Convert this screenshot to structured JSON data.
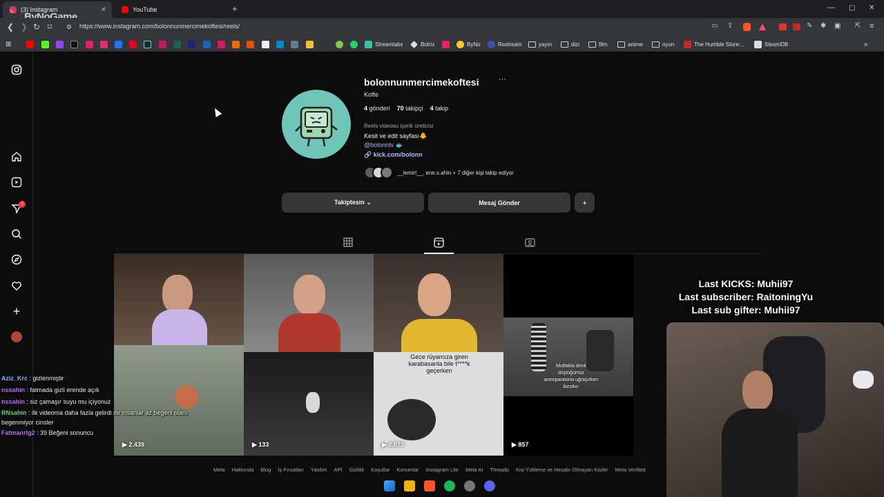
{
  "browser": {
    "tabs": [
      {
        "label": "(3) Instagram",
        "active": true
      },
      {
        "label": "YouTube",
        "active": false
      }
    ],
    "url": "https://www.instagram.com/bolonnunmercimekoftesi/reels/",
    "bookmarks": [
      "Streamlabs",
      "Botrix",
      "ByNo",
      "Restream",
      "yayın",
      "dizi",
      "film",
      "anime",
      "oyun",
      "The Humble Store:...",
      "SteamDB"
    ]
  },
  "watermark": "ByNoGame",
  "profile": {
    "username": "bolonnunmercimekoftesi",
    "more": "···",
    "full_name": "Kofte",
    "stats": {
      "posts_num": "4",
      "posts_label": "gönderi",
      "followers_num": "70",
      "followers_label": "takipçi",
      "following_num": "4",
      "following_label": "takip"
    },
    "category": "Reels videosu içerik üreticisi",
    "bio_line1": "Kesit ve edit sayfası🐥",
    "bio_line2": "@bolonntv 🐟",
    "link": "kick.com/bolonn",
    "followed_by": "__lemirl__, ene.s.ahin + 7 diğer kişi takip ediyor",
    "buttons": {
      "following": "Takiptesin ⌄",
      "message": "Mesaj Gönder",
      "add_user": "+"
    }
  },
  "reels": [
    {
      "views": "2.439",
      "caption": ""
    },
    {
      "views": "133",
      "caption": ""
    },
    {
      "views": "2.873",
      "caption": "Gece rüyamıza giren karabasanla bile t****k geçerken"
    },
    {
      "views": "857",
      "caption": "Mutfakta denk düştüğümüz anneparatoria uğraşırken bizziko:"
    }
  ],
  "footer": [
    "Meta",
    "Hakkında",
    "Blog",
    "İş Fırsatları",
    "Yardım",
    "API",
    "Gizlilik",
    "Koşullar",
    "Konumlar",
    "Instagram Lite",
    "Meta AI",
    "Threads",
    "Kişi Yükleme ve Hesabı Olmayan Kişiler",
    "Meta Verified"
  ],
  "sidenav_badge": "3",
  "overlay": {
    "line1": "Last KICKS: Muhii97",
    "line2": "Last subscriber: RaitoningYu",
    "line3": "Last sub gifter: Muhii97"
  },
  "chat": [
    {
      "user": "Aziz_Krc",
      "color": "#7ab8ff",
      "msg": " : gizlenmiştir"
    },
    {
      "user": "nssahin",
      "color": "#c06bff",
      "msg": " : fatmada gizli erende açık"
    },
    {
      "user": "nssahin",
      "color": "#c06bff",
      "msg": " : siz çamaşır suyu mu içiyonuz"
    },
    {
      "user": "RNsahin",
      "color": "#6bd37a",
      "msg": " : ilk videoma daha fazla gelirdi de insanlar az begeni olanı begenmiyor cinsler"
    },
    {
      "user": "Fatmanrlg2",
      "color": "#c06bff",
      "msg": " : 39 Beğeni sonuncu"
    }
  ]
}
